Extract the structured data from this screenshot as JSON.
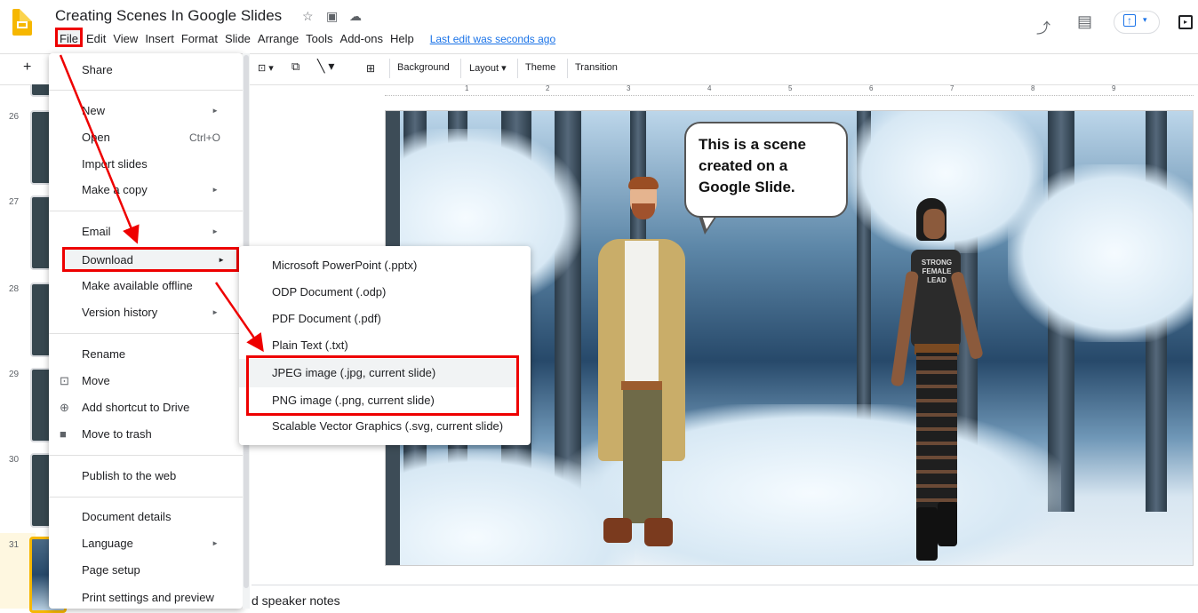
{
  "title": "Creating Scenes In Google Slides",
  "menubar": {
    "items": [
      "File",
      "Edit",
      "View",
      "Insert",
      "Format",
      "Slide",
      "Arrange",
      "Tools",
      "Add-ons",
      "Help"
    ],
    "last_edit": "Last edit was seconds ago"
  },
  "toolbar": {
    "background": "Background",
    "layout": "Layout",
    "theme": "Theme",
    "transition": "Transition"
  },
  "ruler": [
    "1",
    "2",
    "3",
    "4",
    "5",
    "6",
    "7",
    "8",
    "9"
  ],
  "filmstrip": {
    "slide_numbers": [
      "26",
      "27",
      "28",
      "29",
      "30",
      "31"
    ],
    "active": "31"
  },
  "file_menu": {
    "share": "Share",
    "new": "New",
    "open": "Open",
    "open_shortcut": "Ctrl+O",
    "import_slides": "Import slides",
    "make_copy": "Make a copy",
    "email": "Email",
    "download": "Download",
    "offline": "Make available offline",
    "version_history": "Version history",
    "rename": "Rename",
    "move": "Move",
    "add_shortcut": "Add shortcut to Drive",
    "trash": "Move to trash",
    "publish": "Publish to the web",
    "details": "Document details",
    "language": "Language",
    "page_setup": "Page setup",
    "print_settings": "Print settings and preview"
  },
  "download_menu": {
    "pptx": "Microsoft PowerPoint (.pptx)",
    "odp": "ODP Document (.odp)",
    "pdf": "PDF Document (.pdf)",
    "txt": "Plain Text (.txt)",
    "jpeg": "JPEG image (.jpg, current slide)",
    "png": "PNG image (.png, current slide)",
    "svg": "Scalable Vector Graphics (.svg, current slide)"
  },
  "slide": {
    "bubble_text": "This is a scene created on a Google Slide.",
    "shirt_text": "STRONG FEMALE LEAD"
  },
  "speaker_notes": "d speaker notes",
  "colors": {
    "highlight_red": "#ee0000",
    "brand_yellow": "#f6b700",
    "link_blue": "#1a73e8"
  },
  "icons": [
    "star-icon",
    "folder-move-icon",
    "cloud-status-icon",
    "trending-icon",
    "comment-icon",
    "present-icon",
    "side-panel-icon",
    "new-slide-icon",
    "text-box-icon",
    "shape-icon",
    "line-icon",
    "image-icon",
    "comment-add-icon"
  ]
}
